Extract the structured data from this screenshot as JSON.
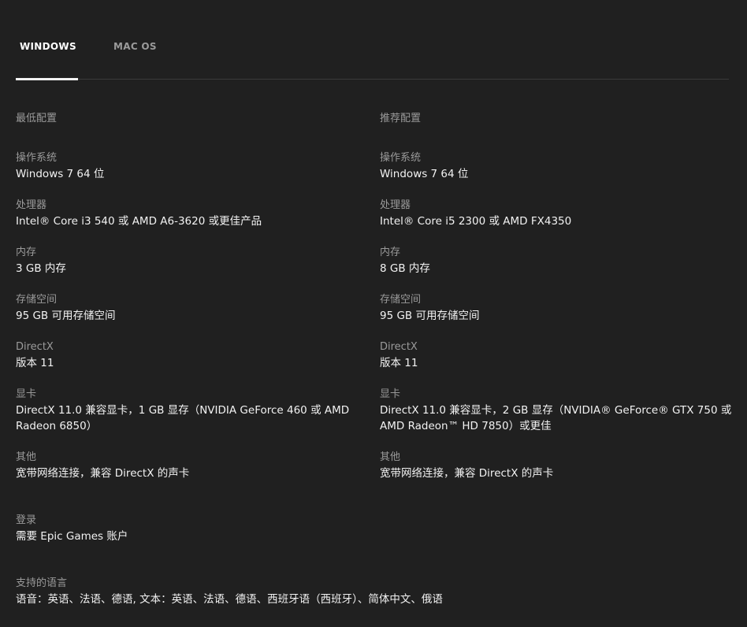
{
  "tabs": [
    {
      "label": "WINDOWS",
      "active": true
    },
    {
      "label": "MAC OS",
      "active": false
    }
  ],
  "minimum": {
    "title": "最低配置",
    "specs": [
      {
        "label": "操作系统",
        "value": "Windows 7 64 位"
      },
      {
        "label": "处理器",
        "value": "Intel® Core i3 540 或 AMD A6-3620 或更佳产品"
      },
      {
        "label": "内存",
        "value": "3 GB 内存"
      },
      {
        "label": "存储空间",
        "value": "95 GB 可用存储空间"
      },
      {
        "label": "DirectX",
        "value": "版本 11"
      },
      {
        "label": "显卡",
        "value": "DirectX 11.0 兼容显卡，1 GB 显存（NVIDIA GeForce 460 或 AMD Radeon 6850）"
      },
      {
        "label": "其他",
        "value": "宽带网络连接，兼容 DirectX 的声卡"
      }
    ]
  },
  "recommended": {
    "title": "推荐配置",
    "specs": [
      {
        "label": "操作系统",
        "value": "Windows 7 64 位"
      },
      {
        "label": "处理器",
        "value": "Intel® Core i5 2300 或 AMD FX4350"
      },
      {
        "label": "内存",
        "value": "8 GB 内存"
      },
      {
        "label": "存储空间",
        "value": "95 GB 可用存储空间"
      },
      {
        "label": "DirectX",
        "value": "版本 11"
      },
      {
        "label": "显卡",
        "value": "DirectX 11.0 兼容显卡，2 GB 显存（NVIDIA® GeForce® GTX 750 或 AMD Radeon™ HD 7850）或更佳"
      },
      {
        "label": "其他",
        "value": "宽带网络连接，兼容 DirectX 的声卡"
      }
    ]
  },
  "login": {
    "label": "登录",
    "value": "需要 Epic Games 账户"
  },
  "languages": {
    "label": "支持的语言",
    "value": "语音：英语、法语、德语, 文本：英语、法语、德语、西班牙语（西班牙）、简体中文、俄语"
  }
}
